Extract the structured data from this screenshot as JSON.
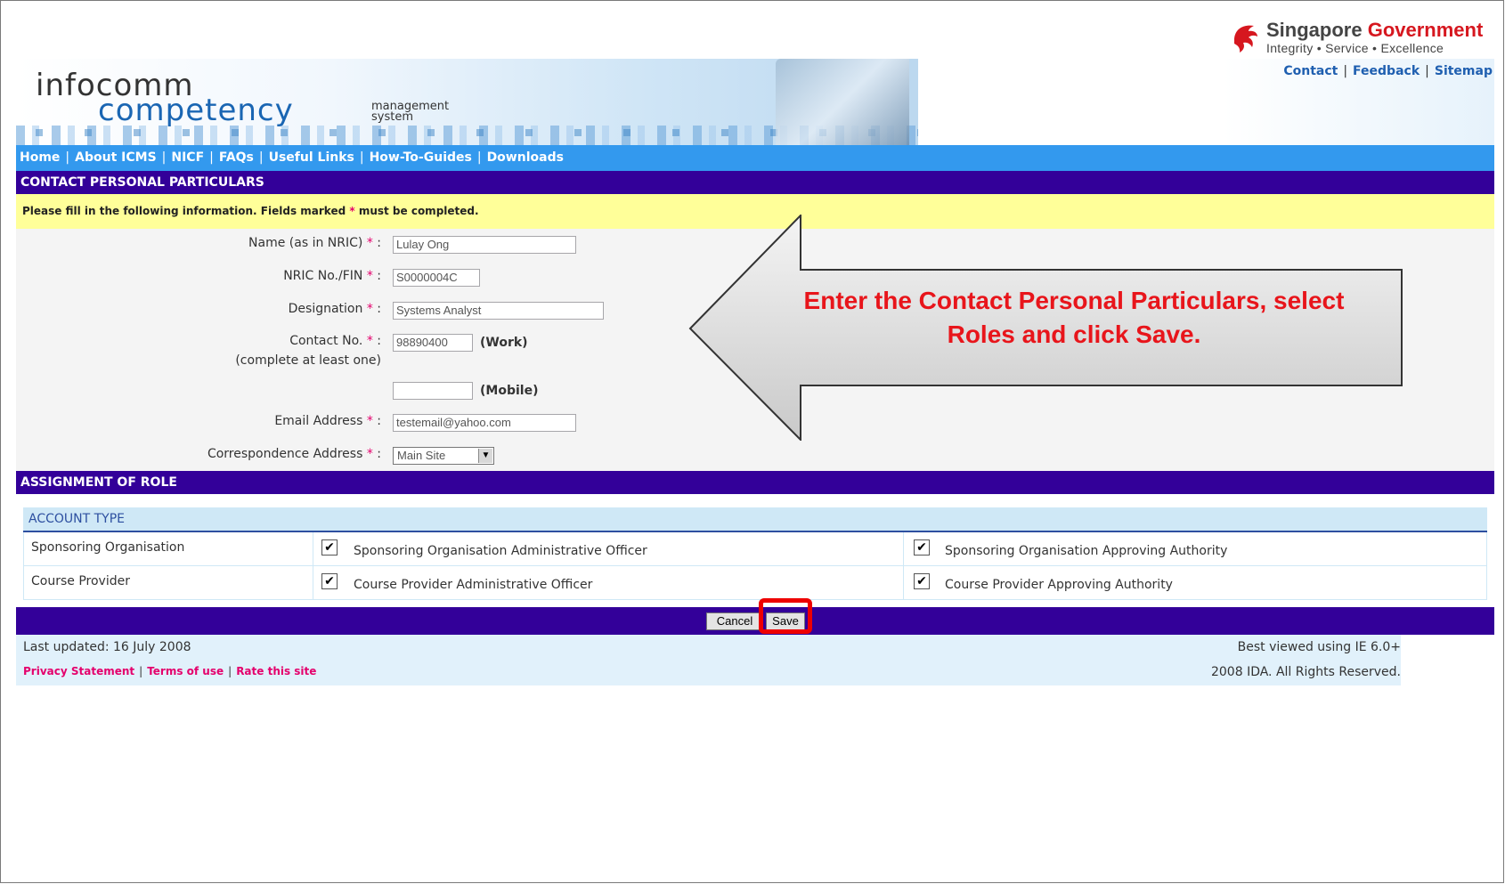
{
  "gov": {
    "title_prefix": "Singapore",
    "title_accent": "Government",
    "tagline": "Integrity • Service • Excellence"
  },
  "top_links": [
    "Contact",
    "Feedback",
    "Sitemap"
  ],
  "banner": {
    "line1": "infocomm",
    "line2": "competency",
    "line3a": "management",
    "line3b": "system"
  },
  "nav": [
    "Home",
    "About ICMS",
    "NICF",
    "FAQs",
    "Useful Links",
    "How-To-Guides",
    "Downloads"
  ],
  "section1": "CONTACT PERSONAL PARTICULARS",
  "notice": {
    "before": "Please fill in the following information. Fields marked ",
    "star": "*",
    "after": " must be completed."
  },
  "form": {
    "name_label": "Name (as in NRIC)",
    "name_value": "Lulay Ong",
    "nric_label": "NRIC No./FIN",
    "nric_value": "S0000004C",
    "designation_label": "Designation",
    "designation_value": "Systems Analyst",
    "contact_label": "Contact No.",
    "contact_sub": "(complete at least one)",
    "work_value": "98890400",
    "work_suffix": "(Work)",
    "mobile_value": "",
    "mobile_suffix": "(Mobile)",
    "email_label": "Email Address",
    "email_value": "testemail@yahoo.com",
    "address_label": "Correspondence Address",
    "address_value": "Main Site",
    "required_mark": "*",
    "colon": ":"
  },
  "section2": "ASSIGNMENT OF ROLE",
  "roles": {
    "header": "ACCOUNT TYPE",
    "rows": [
      {
        "type": "Sponsoring Organisation",
        "role1": "Sponsoring Organisation Administrative Officer",
        "role2": "Sponsoring Organisation Approving Authority"
      },
      {
        "type": "Course Provider",
        "role1": "Course Provider Administrative Officer",
        "role2": "Course Provider Approving Authority"
      }
    ],
    "check": "✔"
  },
  "buttons": {
    "cancel": "Cancel",
    "save": "Save"
  },
  "footer": {
    "updated": "Last updated: 16 July 2008",
    "best": "Best viewed using IE 6.0+",
    "links": [
      "Privacy Statement",
      "Terms of use",
      "Rate this site"
    ],
    "rights": "2008 IDA. All Rights Reserved."
  },
  "callout": {
    "line1": "Enter the Contact Personal Particulars, select",
    "line2": "Roles and click Save."
  },
  "colors": {
    "nav": "#3399ee",
    "section": "#330099",
    "notice": "#ffff99",
    "required": "#e4006c",
    "callout_text": "#e8151b",
    "highlight": "#ee0000"
  }
}
